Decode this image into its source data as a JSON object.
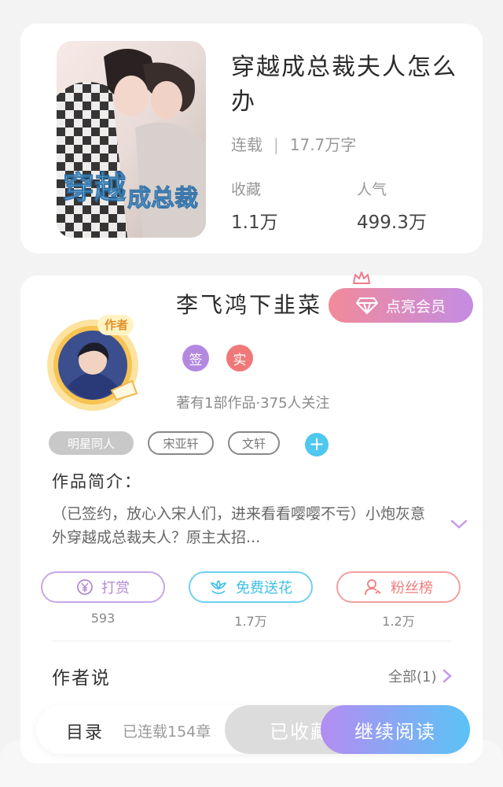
{
  "book": {
    "title": "穿越成总裁夫人怎么办",
    "status": "连载",
    "word_count": "17.7万字",
    "favorites_label": "收藏",
    "favorites_value": "1.1万",
    "popularity_label": "人气",
    "popularity_value": "499.3万",
    "cover_text": "穿越成总裁夫人"
  },
  "author": {
    "name": "李飞鸿下韭菜",
    "badge_text": "作者",
    "vip_button": "点亮会员",
    "badges": [
      "签",
      "实"
    ],
    "stats": "著有1部作品·375人关注"
  },
  "tags": [
    "明星同人",
    "宋亚轩",
    "文轩"
  ],
  "intro": {
    "heading": "作品简介：",
    "text": "（已签约，放心入宋人们，进来看看嘤嘤不亏）小炮灰意外穿越成总裁夫人？原主太招..."
  },
  "actions": [
    {
      "label": "打赏",
      "value": "593",
      "icon": "yen-coin-icon",
      "color": "#b38ad8"
    },
    {
      "label": "免费送花",
      "value": "1.7万",
      "icon": "flower-icon",
      "color": "#3fc0e6"
    },
    {
      "label": "粉丝榜",
      "value": "1.2万",
      "icon": "user-rank-icon",
      "color": "#ef7c7c"
    }
  ],
  "author_say": {
    "heading": "作者说",
    "all_label": "全部(1)"
  },
  "bottom": {
    "toc": "目录",
    "chapters": "已连载154章",
    "collected": "已收藏",
    "continue": "继续阅读"
  },
  "colors": {
    "accent_purple": "#c48ce3",
    "accent_pink": "#f28a9a",
    "accent_blue": "#5bc3f5"
  }
}
